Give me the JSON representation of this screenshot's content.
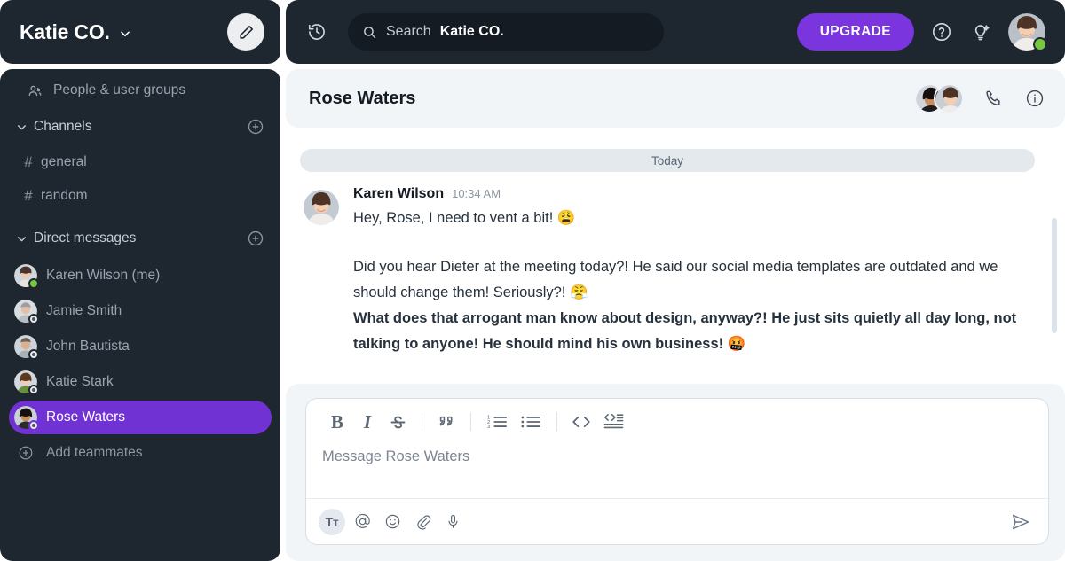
{
  "workspace": {
    "name": "Katie CO.",
    "chevron_icon": "chevron-down-icon",
    "compose_icon": "pencil-icon"
  },
  "sidebar": {
    "people_item": {
      "label": "People & user groups",
      "icon": "people-icon"
    },
    "channels_section": {
      "label": "Channels",
      "add_icon": "plus-circle-icon",
      "caret_icon": "chevron-down-icon",
      "items": [
        {
          "label": "general",
          "prefix": "#"
        },
        {
          "label": "random",
          "prefix": "#"
        }
      ]
    },
    "dm_section": {
      "label": "Direct messages",
      "add_icon": "plus-circle-icon",
      "caret_icon": "chevron-down-icon",
      "items": [
        {
          "label": "Karen Wilson (me)",
          "status": "online",
          "active": false
        },
        {
          "label": "Jamie Smith",
          "status": "offline",
          "active": false
        },
        {
          "label": "John Bautista",
          "status": "offline",
          "active": false
        },
        {
          "label": "Katie Stark",
          "status": "offline",
          "active": false
        },
        {
          "label": "Rose Waters",
          "status": "offline",
          "active": true
        }
      ],
      "add_teammates": {
        "label": "Add teammates",
        "icon": "plus-circle-icon"
      }
    }
  },
  "topbar": {
    "history_icon": "history-clock-icon",
    "search": {
      "icon": "search-icon",
      "placeholder": "Search",
      "value": "Katie CO."
    },
    "upgrade_label": "UPGRADE",
    "help_icon": "help-circle-icon",
    "ideas_icon": "lightbulb-sparkle-icon",
    "avatar": {
      "name": "avatar",
      "status": "online"
    }
  },
  "conversation": {
    "title": "Rose Waters",
    "call_icon": "phone-icon",
    "info_icon": "info-circle-icon",
    "members": [
      "Rose Waters",
      "Karen Wilson"
    ],
    "day_divider": "Today",
    "messages": [
      {
        "author": "Karen Wilson",
        "time": "10:34 AM",
        "lines": [
          {
            "text": "Hey, Rose, I need to vent a bit! 😩",
            "bold": false
          }
        ]
      },
      {
        "author": "",
        "time": "",
        "lines": [
          {
            "text": "Did you hear Dieter at the meeting today?! He said our social media templates are outdated and we should change them! Seriously?! 😤",
            "bold": false
          },
          {
            "text": "What does that arrogant man know about design, anyway?! He just sits quietly all day long, not talking to anyone! He should mind his own business! 🤬",
            "bold": true
          }
        ]
      }
    ]
  },
  "composer": {
    "placeholder": "Message Rose Waters",
    "format_buttons": [
      {
        "name": "bold-button",
        "label": "B"
      },
      {
        "name": "italic-button",
        "label": "I"
      },
      {
        "name": "strikethrough-button",
        "label": "S"
      },
      {
        "name": "blockquote-button",
        "label": "❞"
      },
      {
        "name": "ordered-list-button",
        "label": "ol"
      },
      {
        "name": "bulleted-list-button",
        "label": "ul"
      },
      {
        "name": "code-button",
        "label": "<>"
      },
      {
        "name": "code-block-button",
        "label": "code-block"
      }
    ],
    "tool_buttons": [
      {
        "name": "text-format-button",
        "label": "Tᴛ"
      },
      {
        "name": "mention-button",
        "label": "@"
      },
      {
        "name": "emoji-button",
        "label": "☺"
      },
      {
        "name": "attach-button",
        "label": "📎"
      },
      {
        "name": "voice-button",
        "label": "🎤"
      }
    ],
    "send_label": "send-icon"
  },
  "colors": {
    "sidebar_bg": "#1e2630",
    "accent_purple": "#7132d4",
    "upgrade_purple": "#7a35de",
    "panel_bg": "#f2f5f8",
    "online_green": "#78c742"
  }
}
